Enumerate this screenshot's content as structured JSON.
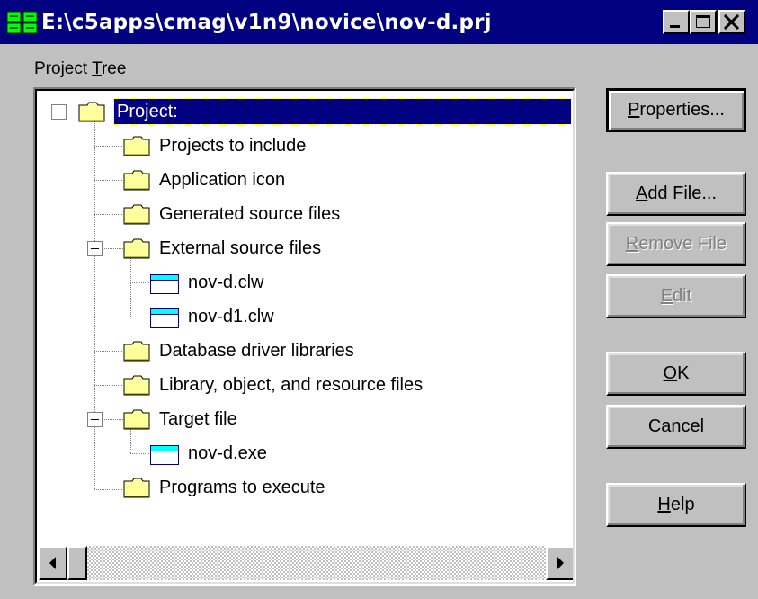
{
  "window": {
    "title": "E:\\c5apps\\cmag\\v1n9\\novice\\nov-d.prj"
  },
  "tree_label": {
    "accel": "T",
    "pre": "Project ",
    "post": "ree"
  },
  "tree": {
    "items": [
      {
        "label": "Project:",
        "icon": "folder-icon",
        "selected": true
      },
      {
        "label": "Projects to include",
        "icon": "folder-icon"
      },
      {
        "label": "Application icon",
        "icon": "folder-icon"
      },
      {
        "label": "Generated source files",
        "icon": "folder-icon"
      },
      {
        "label": "External source files",
        "icon": "folder-icon"
      },
      {
        "label": "nov-d.clw",
        "icon": "file-icon"
      },
      {
        "label": "nov-d1.clw",
        "icon": "file-icon"
      },
      {
        "label": "Database driver libraries",
        "icon": "folder-icon"
      },
      {
        "label": "Library, object, and resource files",
        "icon": "folder-icon"
      },
      {
        "label": "Target file",
        "icon": "folder-icon"
      },
      {
        "label": "nov-d.exe",
        "icon": "file-icon"
      },
      {
        "label": "Programs to execute",
        "icon": "folder-icon"
      }
    ]
  },
  "buttons": {
    "properties": {
      "accel": "P",
      "rest": "roperties..."
    },
    "add_file": {
      "accel": "A",
      "rest": "dd File..."
    },
    "remove_file": {
      "accel": "R",
      "rest": "emove File"
    },
    "edit": {
      "accel": "E",
      "rest": "dit"
    },
    "ok": {
      "accel": "O",
      "rest": "K"
    },
    "cancel": {
      "label": "Cancel"
    },
    "help": {
      "accel": "H",
      "rest": "elp"
    }
  },
  "colors": {
    "titlebar": "#000080",
    "face": "#c0c0c0",
    "selection": "#000080",
    "folder": "#ffff99",
    "file_band": "#00ffff"
  }
}
